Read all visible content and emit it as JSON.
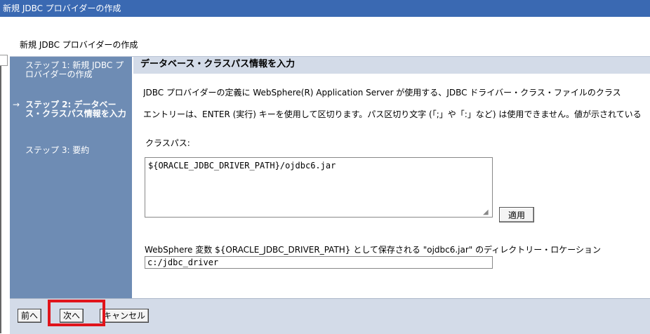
{
  "window": {
    "title": "新規 JDBC プロバイダーの作成"
  },
  "page": {
    "heading": "新規 JDBC プロバイダーの作成"
  },
  "steps": [
    {
      "label": "ステップ 1: 新規 JDBC プロバイダーの作成",
      "current": false
    },
    {
      "label": "ステップ 2: データベース・クラスパス情報を入力",
      "current": true,
      "marker": "→"
    },
    {
      "label": "ステップ 3: 要約",
      "current": false
    }
  ],
  "main": {
    "section_title": "データベース・クラスパス情報を入力",
    "description_1": "JDBC プロバイダーの定義に WebSphere(R) Application Server が使用する、JDBC ドライバー・クラス・ファイルのクラス",
    "description_2": "エントリーは、ENTER (実行) キーを使用して区切ります。パス区切り文字 (「;」や「:」など) は使用できません。値が示されている",
    "classpath_label": "クラスパス:",
    "classpath_value": "${ORACLE_JDBC_DRIVER_PATH}/ojdbc6.jar",
    "apply_label": "適用",
    "ws_variable_label": "WebSphere 変数 ${ORACLE_JDBC_DRIVER_PATH} として保存される \"ojdbc6.jar\" のディレクトリー・ロケーション",
    "location_value": "c:/jdbc_driver"
  },
  "footer": {
    "prev_label": "前へ",
    "next_label": "次へ",
    "cancel_label": "キャンセル"
  },
  "colors": {
    "title_bar": "#3a69b2",
    "sidebar": "#6e8cb4",
    "header": "#d3dbe8",
    "highlight": "#e0141b"
  }
}
